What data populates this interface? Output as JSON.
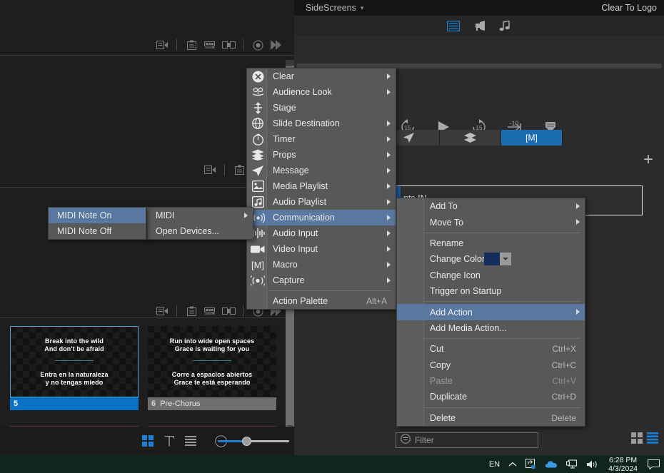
{
  "right_panel": {
    "title": "SideScreens",
    "clear_to_logo": "Clear To Logo",
    "view_icons": [
      "text-view-icon",
      "announcement-icon",
      "music-icon"
    ],
    "transport_icons": [
      "rewind-15-icon",
      "play-icon",
      "forward-15-icon",
      "skip-minus-10-icon",
      "layers-stack-icon"
    ],
    "tabs": [
      {
        "name": "tab-blank",
        "icon": ""
      },
      {
        "name": "tab-timer",
        "icon": "timer-icon",
        "active": false
      },
      {
        "name": "tab-message",
        "icon": "message-send-icon",
        "active": false
      },
      {
        "name": "tab-props",
        "icon": "props-layers-icon",
        "active": false
      },
      {
        "name": "tab-macro",
        "icon": "macro-bracket-m-icon",
        "active": true,
        "label": "[M]"
      }
    ],
    "add_button": "+",
    "selected_item_text": "nts IN",
    "filter_placeholder": "Filter",
    "filter_icon": "filter-icon",
    "view_toggle_grid": "grid-view-icon",
    "view_toggle_list": "list-view-icon"
  },
  "left_panel": {
    "toolbar_icons": [
      "transition-in-icon",
      "clipboard-icon",
      "transition-loop-icon",
      "split-slide-icon",
      "record-icon",
      "next-icon"
    ],
    "slides": [
      {
        "number": "5",
        "label": "",
        "selected": true,
        "lines_en": [
          "Break into the wild",
          "And don't be afraid"
        ],
        "lines_es": [
          "Entra en la naturaleza",
          "y no tengas miedo"
        ]
      },
      {
        "number": "6",
        "label": "Pre-Chorus",
        "selected": false,
        "lines_en": [
          "Run into wide open spaces",
          "Grace is waiting for you"
        ],
        "lines_es": [
          "Corre a espacios abiertos",
          "Grace te está esperando"
        ]
      }
    ],
    "bottom_icons": [
      "grid-view-icon",
      "text-view-icon",
      "list-view-icon",
      "more-options-icon"
    ],
    "zoom_slider_value": 38
  },
  "menu_actions": {
    "items": [
      {
        "label": "Clear",
        "icon": "clear-x-icon",
        "submenu": true
      },
      {
        "label": "Audience Look",
        "icon": "audience-look-icon",
        "submenu": true
      },
      {
        "label": "Stage",
        "icon": "stage-icon",
        "submenu": false
      },
      {
        "label": "Slide Destination",
        "icon": "slide-destination-icon",
        "submenu": true
      },
      {
        "label": "Timer",
        "icon": "timer-icon",
        "submenu": true
      },
      {
        "label": "Props",
        "icon": "props-layers-icon",
        "submenu": true
      },
      {
        "label": "Message",
        "icon": "message-send-icon",
        "submenu": true
      },
      {
        "label": "Media Playlist",
        "icon": "media-playlist-icon",
        "submenu": true
      },
      {
        "label": "Audio Playlist",
        "icon": "audio-playlist-icon",
        "submenu": true
      },
      {
        "label": "Communication",
        "icon": "communication-icon",
        "submenu": true,
        "highlighted": true
      },
      {
        "label": "Audio Input",
        "icon": "audio-input-icon",
        "submenu": true
      },
      {
        "label": "Video Input",
        "icon": "video-input-icon",
        "submenu": true
      },
      {
        "label": "Macro",
        "icon": "macro-bracket-m-icon",
        "submenu": true
      },
      {
        "label": "Capture",
        "icon": "capture-icon",
        "submenu": true
      },
      {
        "label": "Action Palette",
        "icon": "",
        "submenu": false,
        "accel": "Alt+A",
        "separator_before": true
      }
    ]
  },
  "menu_communication": {
    "items": [
      {
        "label": "MIDI",
        "submenu": true,
        "highlighted": false
      },
      {
        "label": "Open Devices...",
        "submenu": false
      }
    ]
  },
  "menu_midi": {
    "items": [
      {
        "label": "MIDI Note On",
        "highlighted": true
      },
      {
        "label": "MIDI Note Off",
        "highlighted": false
      }
    ]
  },
  "menu_context": {
    "items": [
      {
        "label": "Add To",
        "submenu": true
      },
      {
        "label": "Move To",
        "submenu": true
      },
      {
        "label": "Rename",
        "submenu": false,
        "separator_before": true
      },
      {
        "label": "Change Color",
        "submenu": false,
        "color_swatch": "#132e5c"
      },
      {
        "label": "Change Icon",
        "submenu": false
      },
      {
        "label": "Trigger on Startup",
        "submenu": false
      },
      {
        "label": "Add Action",
        "submenu": true,
        "highlighted": true,
        "separator_before": true
      },
      {
        "label": "Add Media Action...",
        "submenu": false
      },
      {
        "label": "Cut",
        "accel": "Ctrl+X",
        "separator_before": true
      },
      {
        "label": "Copy",
        "accel": "Ctrl+C"
      },
      {
        "label": "Paste",
        "accel": "Ctrl+V",
        "disabled": true
      },
      {
        "label": "Duplicate",
        "accel": "Ctrl+D"
      },
      {
        "label": "Delete",
        "accel": "Delete",
        "separator_before": true
      }
    ]
  },
  "taskbar": {
    "language": "EN",
    "tray_icons": [
      "chevron-up-icon",
      "sync-share-icon",
      "onedrive-cloud-icon",
      "display-icon",
      "volume-icon"
    ],
    "time": "6:28 PM",
    "date": "4/3/2024",
    "notification_icon": "notification-icon"
  }
}
